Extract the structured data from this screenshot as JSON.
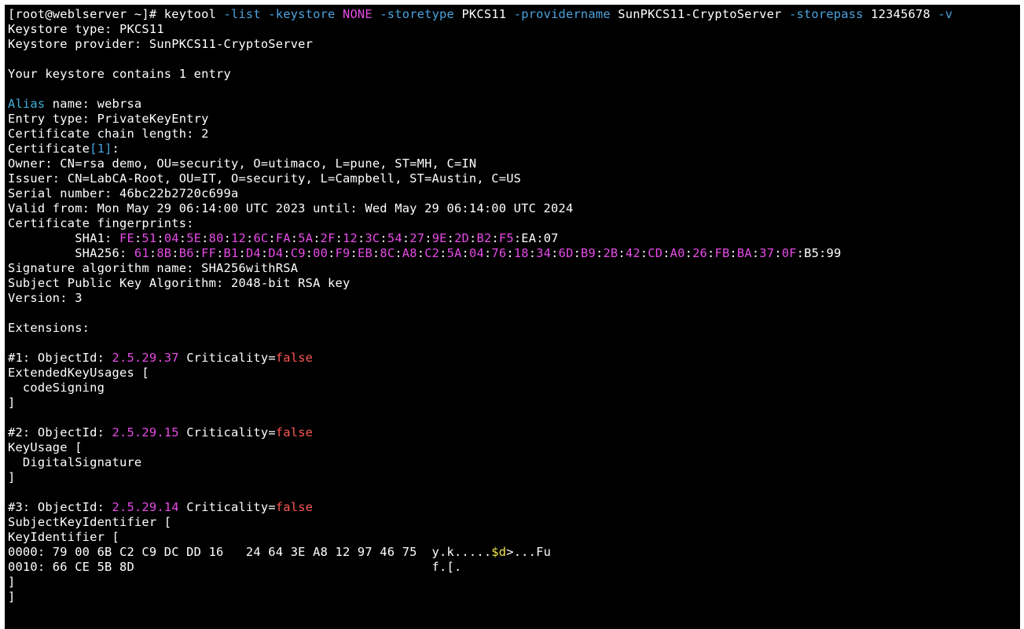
{
  "terminal": {
    "lines": [
      [
        [
          "[root@weblserver ~]# keytool ",
          "white"
        ],
        [
          "-list -keystore ",
          "blue"
        ],
        [
          "NONE ",
          "magenta"
        ],
        [
          "-storetype ",
          "blue"
        ],
        [
          "PKCS11 ",
          "white"
        ],
        [
          "-providername ",
          "blue"
        ],
        [
          "SunPKCS11-CryptoServer ",
          "white"
        ],
        [
          "-storepass ",
          "blue"
        ],
        [
          "12345678 ",
          "white"
        ],
        [
          "-v",
          "blue"
        ]
      ],
      [
        [
          "Keystore type: PKCS11",
          "white"
        ]
      ],
      [
        [
          "Keystore provider: SunPKCS11-CryptoServer",
          "white"
        ]
      ],
      [
        [
          "",
          "white"
        ]
      ],
      [
        [
          "Your keystore contains 1 entry",
          "white"
        ]
      ],
      [
        [
          "",
          "white"
        ]
      ],
      [
        [
          "Alias",
          "cyan"
        ],
        [
          " name: webrsa",
          "white"
        ]
      ],
      [
        [
          "Entry type: PrivateKeyEntry",
          "white"
        ]
      ],
      [
        [
          "Certificate chain length: 2",
          "white"
        ]
      ],
      [
        [
          "Certificate",
          "white"
        ],
        [
          "[1]",
          "blue"
        ],
        [
          ":",
          "white"
        ]
      ],
      [
        [
          "Owner: CN=rsa demo, OU=security, O=utimaco, L=pune, ST=MH, C=IN",
          "white"
        ]
      ],
      [
        [
          "Issuer: CN=LabCA-Root, OU=IT, O=security, L=Campbell, ST=Austin, C=US",
          "white"
        ]
      ],
      [
        [
          "Serial number: 46bc22b2720c699a",
          "white"
        ]
      ],
      [
        [
          "Valid from: Mon May 29 06:14:00 UTC 2023 until: Wed May 29 06:14:00 UTC 2024",
          "white"
        ]
      ],
      [
        [
          "Certificate fingerprints:",
          "white"
        ]
      ],
      [
        [
          "         SHA1: ",
          "white"
        ],
        [
          "FE",
          "magenta"
        ],
        [
          ":",
          "white"
        ],
        [
          "51",
          "magenta"
        ],
        [
          ":",
          "white"
        ],
        [
          "04",
          "magenta"
        ],
        [
          ":",
          "white"
        ],
        [
          "5E",
          "magenta"
        ],
        [
          ":",
          "white"
        ],
        [
          "80",
          "magenta"
        ],
        [
          ":",
          "white"
        ],
        [
          "12",
          "magenta"
        ],
        [
          ":",
          "white"
        ],
        [
          "6C",
          "magenta"
        ],
        [
          ":",
          "white"
        ],
        [
          "FA",
          "magenta"
        ],
        [
          ":",
          "white"
        ],
        [
          "5A",
          "magenta"
        ],
        [
          ":",
          "white"
        ],
        [
          "2F",
          "magenta"
        ],
        [
          ":",
          "white"
        ],
        [
          "12",
          "magenta"
        ],
        [
          ":",
          "white"
        ],
        [
          "3C",
          "magenta"
        ],
        [
          ":",
          "white"
        ],
        [
          "54",
          "magenta"
        ],
        [
          ":",
          "white"
        ],
        [
          "27",
          "magenta"
        ],
        [
          ":",
          "white"
        ],
        [
          "9E",
          "magenta"
        ],
        [
          ":",
          "white"
        ],
        [
          "2D",
          "magenta"
        ],
        [
          ":",
          "white"
        ],
        [
          "B2",
          "magenta"
        ],
        [
          ":",
          "white"
        ],
        [
          "F5",
          "magenta"
        ],
        [
          ":EA:07",
          "white"
        ]
      ],
      [
        [
          "         SHA256: ",
          "white"
        ],
        [
          "61",
          "magenta"
        ],
        [
          ":",
          "white"
        ],
        [
          "8B",
          "magenta"
        ],
        [
          ":",
          "white"
        ],
        [
          "B6",
          "magenta"
        ],
        [
          ":",
          "white"
        ],
        [
          "FF",
          "magenta"
        ],
        [
          ":",
          "white"
        ],
        [
          "B1",
          "magenta"
        ],
        [
          ":",
          "white"
        ],
        [
          "D4",
          "magenta"
        ],
        [
          ":",
          "white"
        ],
        [
          "D4",
          "magenta"
        ],
        [
          ":",
          "white"
        ],
        [
          "C9",
          "magenta"
        ],
        [
          ":",
          "white"
        ],
        [
          "00",
          "magenta"
        ],
        [
          ":",
          "white"
        ],
        [
          "F9",
          "magenta"
        ],
        [
          ":",
          "white"
        ],
        [
          "EB",
          "magenta"
        ],
        [
          ":",
          "white"
        ],
        [
          "8C",
          "magenta"
        ],
        [
          ":",
          "white"
        ],
        [
          "A8",
          "magenta"
        ],
        [
          ":",
          "white"
        ],
        [
          "C2",
          "magenta"
        ],
        [
          ":",
          "white"
        ],
        [
          "5A",
          "magenta"
        ],
        [
          ":",
          "white"
        ],
        [
          "04",
          "magenta"
        ],
        [
          ":",
          "white"
        ],
        [
          "76",
          "magenta"
        ],
        [
          ":",
          "white"
        ],
        [
          "18",
          "magenta"
        ],
        [
          ":",
          "white"
        ],
        [
          "34",
          "magenta"
        ],
        [
          ":",
          "white"
        ],
        [
          "6D",
          "magenta"
        ],
        [
          ":",
          "white"
        ],
        [
          "B9",
          "magenta"
        ],
        [
          ":",
          "white"
        ],
        [
          "2B",
          "magenta"
        ],
        [
          ":",
          "white"
        ],
        [
          "42",
          "magenta"
        ],
        [
          ":",
          "white"
        ],
        [
          "CD",
          "magenta"
        ],
        [
          ":",
          "white"
        ],
        [
          "A0",
          "magenta"
        ],
        [
          ":",
          "white"
        ],
        [
          "26",
          "magenta"
        ],
        [
          ":",
          "white"
        ],
        [
          "FB",
          "magenta"
        ],
        [
          ":",
          "white"
        ],
        [
          "BA",
          "magenta"
        ],
        [
          ":",
          "white"
        ],
        [
          "37",
          "magenta"
        ],
        [
          ":",
          "white"
        ],
        [
          "0F",
          "magenta"
        ],
        [
          ":B5:99",
          "white"
        ]
      ],
      [
        [
          "Signature algorithm name: SHA256withRSA",
          "white"
        ]
      ],
      [
        [
          "Subject Public Key Algorithm: 2048-bit RSA key",
          "white"
        ]
      ],
      [
        [
          "Version: 3",
          "white"
        ]
      ],
      [
        [
          "",
          "white"
        ]
      ],
      [
        [
          "Extensions:",
          "white"
        ]
      ],
      [
        [
          "",
          "white"
        ]
      ],
      [
        [
          "#1: ObjectId: ",
          "white"
        ],
        [
          "2.5.29.37",
          "magenta"
        ],
        [
          " Criticality=",
          "white"
        ],
        [
          "false",
          "red"
        ]
      ],
      [
        [
          "ExtendedKeyUsages [",
          "white"
        ]
      ],
      [
        [
          "  codeSigning",
          "white"
        ]
      ],
      [
        [
          "]",
          "white"
        ]
      ],
      [
        [
          "",
          "white"
        ]
      ],
      [
        [
          "#2: ObjectId: ",
          "white"
        ],
        [
          "2.5.29.15",
          "magenta"
        ],
        [
          " Criticality=",
          "white"
        ],
        [
          "false",
          "red"
        ]
      ],
      [
        [
          "KeyUsage [",
          "white"
        ]
      ],
      [
        [
          "  DigitalSignature",
          "white"
        ]
      ],
      [
        [
          "]",
          "white"
        ]
      ],
      [
        [
          "",
          "white"
        ]
      ],
      [
        [
          "#3: ObjectId: ",
          "white"
        ],
        [
          "2.5.29.14",
          "magenta"
        ],
        [
          " Criticality=",
          "white"
        ],
        [
          "false",
          "red"
        ]
      ],
      [
        [
          "SubjectKeyIdentifier [",
          "white"
        ]
      ],
      [
        [
          "KeyIdentifier [",
          "white"
        ]
      ],
      [
        [
          "0000: 79 00 6B C2 C9 DC DD 16   24 64 3E A8 12 97 46 75  y.k.....",
          "white"
        ],
        [
          "$d",
          "yellow"
        ],
        [
          ">...Fu",
          "white"
        ]
      ],
      [
        [
          "0010: 66 CE 5B 8D                                        f.[.",
          "white"
        ]
      ],
      [
        [
          "]",
          "white"
        ]
      ],
      [
        [
          "]",
          "white"
        ]
      ]
    ]
  },
  "colors": {
    "white": "#ffffff",
    "blue": "#4aa3df",
    "cyan": "#3fb0d8",
    "magenta": "#e64be6",
    "red": "#ff5555",
    "yellow": "#f1e64a",
    "background": "#000000"
  }
}
